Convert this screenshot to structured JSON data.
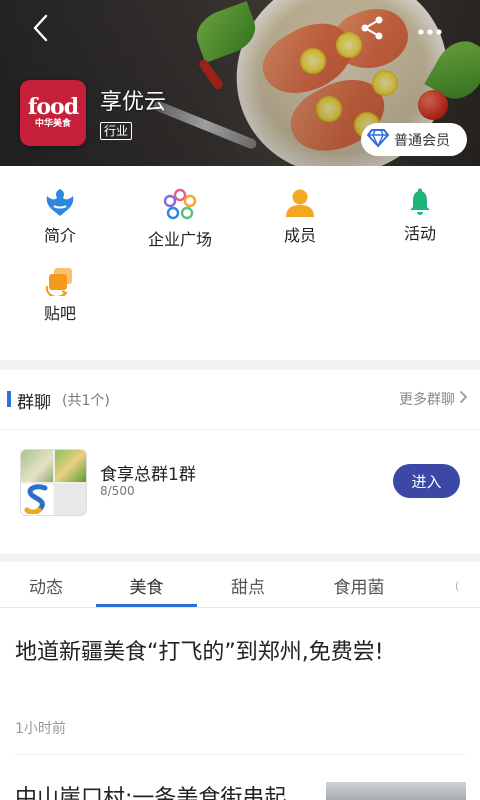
{
  "header": {
    "org_name": "享优云",
    "org_tag": "行业",
    "logo": {
      "line1": "food",
      "line2": "中华美食"
    },
    "member_badge": "普通会员",
    "icons": {
      "back": "back-arrow-icon",
      "share": "share-icon",
      "more": "more-dots-icon",
      "badge": "diamond-icon"
    },
    "colors": {
      "logo_bg": "#c7203a",
      "badge_icon": "#2f6ed6"
    }
  },
  "features": [
    {
      "label": "简介",
      "icon": "intro-icon",
      "color": "#2f86e0"
    },
    {
      "label": "企业广场",
      "icon": "plaza-icon",
      "color": "#7a6fd8"
    },
    {
      "label": "成员",
      "icon": "member-icon",
      "color": "#f5a623"
    },
    {
      "label": "活动",
      "icon": "activity-bell-icon",
      "color": "#1fb57a"
    },
    {
      "label": "贴吧",
      "icon": "forum-icon",
      "color": "#f39a1e"
    }
  ],
  "group_chat": {
    "title": "群聊",
    "count": "(共1个)",
    "more": "更多群聊",
    "items": [
      {
        "name": "食享总群1群",
        "members": "8/500",
        "action": "进入"
      }
    ]
  },
  "tabs": {
    "items": [
      "动态",
      "美食",
      "甜点",
      "食用菌",
      "（"
    ],
    "active": "美食"
  },
  "feed": {
    "articles": [
      {
        "title": "地道新疆美食“打飞的”到郑州,免费尝!",
        "time": "1小时前"
      },
      {
        "title": "中山崖口村:一条美食街串起"
      }
    ]
  }
}
